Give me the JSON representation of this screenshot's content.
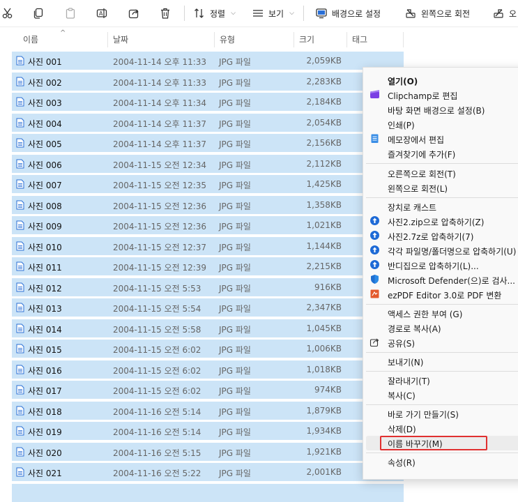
{
  "toolbar": {
    "sort_label": "정렬",
    "view_label": "보기",
    "set_bg_label": "배경으로 설정",
    "rotate_left_label": "왼쪽으로 회전",
    "overflow_label": "오"
  },
  "header": {
    "col_name": "이름",
    "col_date": "날짜",
    "col_type": "유형",
    "col_size": "크기",
    "col_tag": "태그"
  },
  "files": [
    {
      "name": "사진 001",
      "date": "2004-11-14 오후 11:33",
      "type": "JPG 파일",
      "size": "2,059KB"
    },
    {
      "name": "사진 002",
      "date": "2004-11-14 오후 11:33",
      "type": "JPG 파일",
      "size": "2,283KB"
    },
    {
      "name": "사진 003",
      "date": "2004-11-14 오후 11:34",
      "type": "JPG 파일",
      "size": "2,184KB"
    },
    {
      "name": "사진 004",
      "date": "2004-11-14 오후 11:37",
      "type": "JPG 파일",
      "size": "2,054KB"
    },
    {
      "name": "사진 005",
      "date": "2004-11-14 오후 11:37",
      "type": "JPG 파일",
      "size": "2,156KB"
    },
    {
      "name": "사진 006",
      "date": "2004-11-15 오전 12:34",
      "type": "JPG 파일",
      "size": "2,112KB"
    },
    {
      "name": "사진 007",
      "date": "2004-11-15 오전 12:35",
      "type": "JPG 파일",
      "size": "1,425KB"
    },
    {
      "name": "사진 008",
      "date": "2004-11-15 오전 12:36",
      "type": "JPG 파일",
      "size": "1,358KB"
    },
    {
      "name": "사진 009",
      "date": "2004-11-15 오전 12:36",
      "type": "JPG 파일",
      "size": "1,021KB"
    },
    {
      "name": "사진 010",
      "date": "2004-11-15 오전 12:37",
      "type": "JPG 파일",
      "size": "1,144KB"
    },
    {
      "name": "사진 011",
      "date": "2004-11-15 오전 12:39",
      "type": "JPG 파일",
      "size": "2,215KB"
    },
    {
      "name": "사진 012",
      "date": "2004-11-15 오전 5:53",
      "type": "JPG 파일",
      "size": "916KB"
    },
    {
      "name": "사진 013",
      "date": "2004-11-15 오전 5:54",
      "type": "JPG 파일",
      "size": "2,347KB"
    },
    {
      "name": "사진 014",
      "date": "2004-11-15 오전 5:58",
      "type": "JPG 파일",
      "size": "1,045KB"
    },
    {
      "name": "사진 015",
      "date": "2004-11-15 오전 6:02",
      "type": "JPG 파일",
      "size": "1,006KB"
    },
    {
      "name": "사진 016",
      "date": "2004-11-15 오전 6:02",
      "type": "JPG 파일",
      "size": "1,018KB"
    },
    {
      "name": "사진 017",
      "date": "2004-11-15 오전 6:02",
      "type": "JPG 파일",
      "size": "974KB"
    },
    {
      "name": "사진 018",
      "date": "2004-11-16 오전 5:14",
      "type": "JPG 파일",
      "size": "1,879KB"
    },
    {
      "name": "사진 019",
      "date": "2004-11-16 오전 5:14",
      "type": "JPG 파일",
      "size": "1,934KB"
    },
    {
      "name": "사진 020",
      "date": "2004-11-16 오전 5:15",
      "type": "JPG 파일",
      "size": "1,921KB"
    },
    {
      "name": "사진 021",
      "date": "2004-11-16 오전 5:22",
      "type": "JPG 파일",
      "size": "2,001KB"
    }
  ],
  "menu": {
    "open": "열기(O)",
    "clipchamp": "Clipchamp로 편집",
    "set_desktop_bg": "바탕 화면 배경으로 설정(B)",
    "print": "인쇄(P)",
    "notepad": "메모장에서 편집",
    "favorites": "즐겨찾기에 추가(F)",
    "rotate_right": "오른쪽으로 회전(T)",
    "rotate_left": "왼쪽으로 회전(L)",
    "cast": "장치로 캐스트",
    "zip": "사진2.zip으로 압축하기(Z)",
    "sevenz": "사진2.7z로 압축하기(7)",
    "each_file": "각각 파일명/폴더명으로 압축하기(U)",
    "bandizip": "반디집으로 압축하기(L)...",
    "defender": "Microsoft Defender(으)로 검사...",
    "ezpdf": "ezPDF Editor 3.0로 PDF 변환",
    "access": "액세스 권한 부여 (G)",
    "copy_path": "경로로 복사(A)",
    "share": "공유(S)",
    "send_to": "보내기(N)",
    "cut": "잘라내기(T)",
    "copy": "복사(C)",
    "shortcut": "바로 가기 만들기(S)",
    "delete": "삭제(D)",
    "rename": "이름 바꾸기(M)",
    "properties": "속성(R)"
  },
  "colors": {
    "selection": "#cce4f7",
    "highlight_box": "#e03030"
  }
}
